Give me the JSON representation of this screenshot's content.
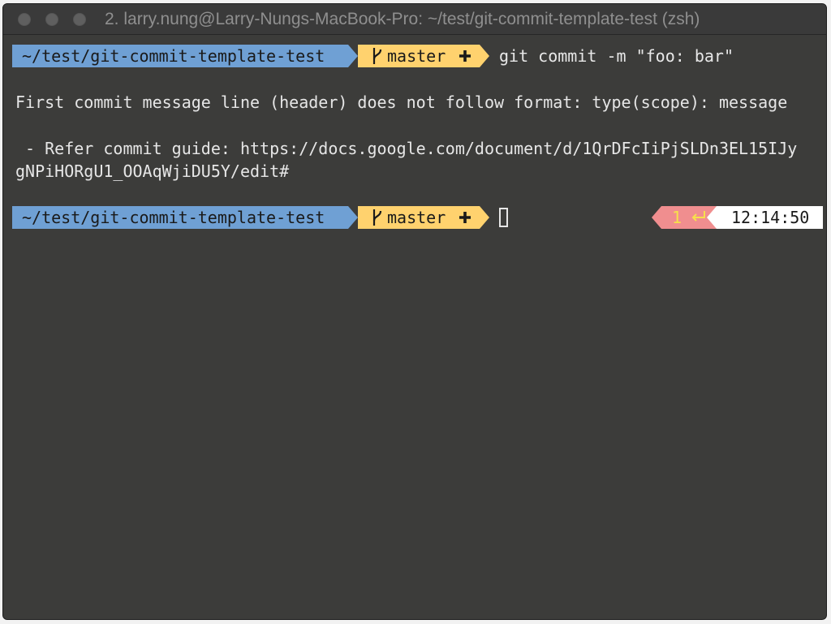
{
  "window": {
    "title": "2. larry.nung@Larry-Nungs-MacBook-Pro: ~/test/git-commit-template-test (zsh)"
  },
  "prompt1": {
    "directory": "~/test/git-commit-template-test",
    "branch": "master",
    "branch_icon": "git-branch-icon",
    "dirty_icon": "plus-icon",
    "command": "git commit -m \"foo: bar\""
  },
  "output": {
    "line1": "First commit message line (header) does not follow format: type(scope): message",
    "line2": " - Refer commit guide: https://docs.google.com/document/d/1QrDFcIiPjSLDn3EL15IJy",
    "line3": "gNPiHORgU1_OOAqWjiDU5Y/edit#"
  },
  "prompt2": {
    "directory": "~/test/git-commit-template-test",
    "branch": "master",
    "exit_code": "1",
    "return_icon": "return-arrow-icon",
    "time": "12:14:50"
  },
  "colors": {
    "background": "#3c3c3a",
    "dir_segment": "#6fa0d4",
    "git_segment": "#ffd26e",
    "status_segment": "#f08e8f",
    "time_segment": "#ffffff"
  }
}
